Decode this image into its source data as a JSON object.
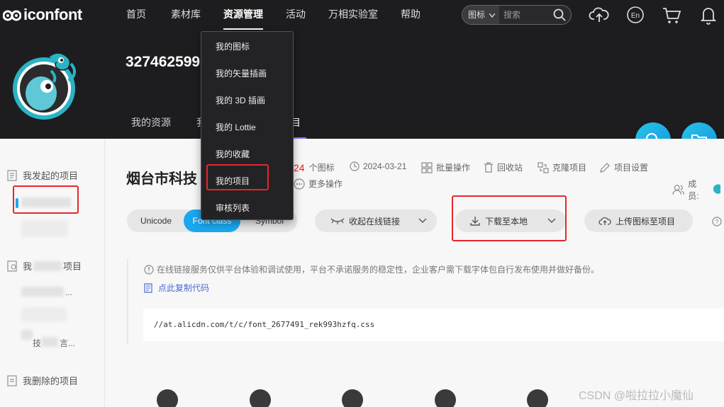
{
  "app": {
    "logo_text": "iconfont"
  },
  "nav": {
    "items": [
      {
        "label": "首页"
      },
      {
        "label": "素材库"
      },
      {
        "label": "资源管理"
      },
      {
        "label": "活动"
      },
      {
        "label": "万相实验室"
      },
      {
        "label": "帮助"
      }
    ]
  },
  "search": {
    "type_label": "图标",
    "placeholder": "搜索"
  },
  "profile": {
    "user_id": "327462599",
    "tabs": [
      {
        "label": "我的资源"
      },
      {
        "label": "我"
      },
      {
        "label": "目"
      }
    ]
  },
  "dropdown": {
    "items": [
      {
        "label": "我的图标"
      },
      {
        "label": "我的矢量插画"
      },
      {
        "label": "我的 3D 插画"
      },
      {
        "label": "我的 Lottie"
      },
      {
        "label": "我的收藏"
      },
      {
        "label": "我的项目"
      },
      {
        "label": "审核列表"
      }
    ]
  },
  "sidebar": {
    "sections": [
      {
        "label": "我发起的项目"
      },
      {
        "label": "我",
        "suffix": "项目"
      },
      {
        "label": "我删除的项目"
      }
    ],
    "fragments": {
      "dots": "...",
      "ji": "技",
      "shang": "言..."
    }
  },
  "project": {
    "title": "烟台市科技",
    "icon_count": "24",
    "icon_unit": "个图标",
    "date": "2024-03-21",
    "actions": {
      "batch": "批量操作",
      "recycle": "回收站",
      "clone": "克隆项目",
      "settings": "项目设置",
      "more": "更多操作",
      "members": "成员:"
    }
  },
  "format_tabs": [
    {
      "label": "Unicode"
    },
    {
      "label": "Font class"
    },
    {
      "label": "Symbol"
    }
  ],
  "buttons": {
    "collapse_link": "收起在线链接",
    "download": "下载至本地",
    "upload": "上传图标至项目"
  },
  "notice": {
    "text": "在线链接服务仅供平台体验和调试使用，平台不承诺服务的稳定性，企业客户需下载字体包自行发布使用并做好备份。",
    "copy_link": "点此复制代码",
    "code": "//at.alicdn.com/t/c/font_2677491_rek993hzfq.css"
  },
  "watermark": "CSDN @啦拉拉小魔仙",
  "colors": {
    "accent": "#1aa7ee",
    "top_bg": "#1d1d1f",
    "highlight": "#e8262b",
    "link": "#4b6bd6"
  }
}
